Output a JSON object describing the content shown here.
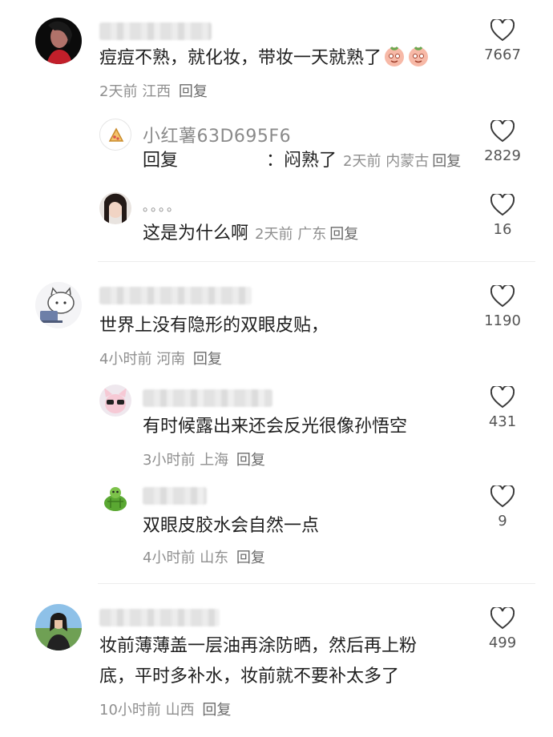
{
  "comments": [
    {
      "text": "痘痘不熟，就化妆，带妆一天就熟了",
      "emoji_icon": "peach-face-emoji",
      "time": "2天前",
      "location": "江西",
      "reply_label": "回复",
      "likes": "7667",
      "replies": [
        {
          "username": "小红薯63D695F6",
          "reply_prefix": "回复",
          "text": "：闷熟了",
          "time": "2天前",
          "location": "内蒙古",
          "reply_label": "回复",
          "likes": "2829"
        },
        {
          "username": "。。。。",
          "text": "这是为什么啊",
          "time": "2天前",
          "location": "广东",
          "reply_label": "回复",
          "likes": "16"
        }
      ]
    },
    {
      "text": "世界上没有隐形的双眼皮贴，",
      "time": "4小时前",
      "location": "河南",
      "reply_label": "回复",
      "likes": "1190",
      "replies": [
        {
          "text": "有时候露出来还会反光很像孙悟空",
          "time": "3小时前",
          "location": "上海",
          "reply_label": "回复",
          "likes": "431"
        },
        {
          "text": "双眼皮胶水会自然一点",
          "time": "4小时前",
          "location": "山东",
          "reply_label": "回复",
          "likes": "9"
        }
      ]
    },
    {
      "text_line1": "妆前薄薄盖一层油再涂防晒，然后再上粉",
      "text_line2": "底，平时多补水，妆前就不要补太多了",
      "time": "10小时前",
      "location": "山西",
      "reply_label": "回复",
      "likes": "499"
    }
  ],
  "icons": {
    "like": "heart-outline-icon",
    "accent": "#e84a5f"
  }
}
